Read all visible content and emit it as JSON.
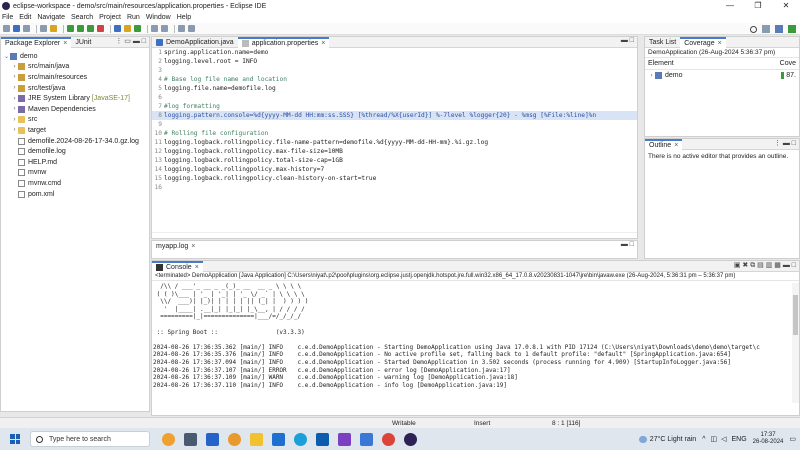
{
  "window": {
    "title": "eclipse-workspace - demo/src/main/resources/application.properties - Eclipse IDE",
    "controls": [
      "—",
      "❐",
      "✕"
    ]
  },
  "menu": [
    "File",
    "Edit",
    "Navigate",
    "Search",
    "Project",
    "Run",
    "Window",
    "Help"
  ],
  "explorer": {
    "tabs": [
      "Package Explorer",
      "JUnit"
    ],
    "items": [
      {
        "indent": 0,
        "twisty": "⌄",
        "icon": "proj",
        "label": "demo",
        "deco": ""
      },
      {
        "indent": 1,
        "twisty": "›",
        "icon": "pkg",
        "label": "src/main/java",
        "deco": ""
      },
      {
        "indent": 1,
        "twisty": "›",
        "icon": "pkg",
        "label": "src/main/resources",
        "deco": ""
      },
      {
        "indent": 1,
        "twisty": "›",
        "icon": "pkg",
        "label": "src/test/java",
        "deco": ""
      },
      {
        "indent": 1,
        "twisty": "›",
        "icon": "jar",
        "label": "JRE System Library",
        "deco": "[JavaSE-17]"
      },
      {
        "indent": 1,
        "twisty": "›",
        "icon": "jar",
        "label": "Maven Dependencies",
        "deco": ""
      },
      {
        "indent": 1,
        "twisty": "›",
        "icon": "folder",
        "label": "src",
        "deco": ""
      },
      {
        "indent": 1,
        "twisty": "›",
        "icon": "folder",
        "label": "target",
        "deco": ""
      },
      {
        "indent": 1,
        "twisty": "",
        "icon": "file",
        "label": "demofile.2024-08-26-17-34.0.gz.log",
        "deco": ""
      },
      {
        "indent": 1,
        "twisty": "",
        "icon": "file",
        "label": "demofile.log",
        "deco": ""
      },
      {
        "indent": 1,
        "twisty": "",
        "icon": "file",
        "label": "HELP.md",
        "deco": ""
      },
      {
        "indent": 1,
        "twisty": "",
        "icon": "file",
        "label": "mvnw",
        "deco": ""
      },
      {
        "indent": 1,
        "twisty": "",
        "icon": "file",
        "label": "mvnw.cmd",
        "deco": ""
      },
      {
        "indent": 1,
        "twisty": "",
        "icon": "file",
        "label": "pom.xml",
        "deco": ""
      }
    ]
  },
  "editor": {
    "tabs": [
      "DemoApplication.java",
      "application.properties"
    ],
    "active_tab": 1,
    "lines": [
      {
        "n": "1",
        "text": "spring.application.name=demo",
        "kind": "prop"
      },
      {
        "n": "2",
        "text": "logging.level.root = INFO",
        "kind": "prop"
      },
      {
        "n": "3",
        "text": "",
        "kind": "prop"
      },
      {
        "n": "4",
        "text": "# Base log file name and location",
        "kind": "comment"
      },
      {
        "n": "5",
        "text": "logging.file.name=demofile.log",
        "kind": "prop"
      },
      {
        "n": "6",
        "text": "",
        "kind": "prop"
      },
      {
        "n": "7",
        "text": "#log formatting",
        "kind": "comment"
      },
      {
        "n": "8",
        "text": "logging.pattern.console=%d{yyyy-MM-dd HH:mm:ss.SSS} [%thread/%X{userId}] %-7level %logger{20} - %msg [%File:%line]%n",
        "kind": "highlight"
      },
      {
        "n": "9",
        "text": "",
        "kind": "prop"
      },
      {
        "n": "10",
        "text": "# Rolling file configuration",
        "kind": "comment"
      },
      {
        "n": "11",
        "text": "logging.logback.rollingpolicy.file-name-pattern=demofile.%d{yyyy-MM-dd-HH-mm}.%i.gz.log",
        "kind": "prop"
      },
      {
        "n": "12",
        "text": "logging.logback.rollingpolicy.max-file-size=10MB",
        "kind": "prop"
      },
      {
        "n": "13",
        "text": "logging.logback.rollingpolicy.total-size-cap=1GB",
        "kind": "prop"
      },
      {
        "n": "14",
        "text": "logging.logback.rollingpolicy.max-history=7",
        "kind": "prop"
      },
      {
        "n": "15",
        "text": "logging.logback.rollingpolicy.clean-history-on-start=true",
        "kind": "prop"
      },
      {
        "n": "16",
        "text": "",
        "kind": "prop"
      }
    ]
  },
  "myapp_tab": "myapp.log",
  "right_top": {
    "tabs": [
      "Task List",
      "Coverage"
    ],
    "session": "DemoApplication (26-Aug-2024 5:36:37 pm)",
    "col_element": "Element",
    "col_coverage": "Cove",
    "row_label": "demo",
    "row_value": "87."
  },
  "outline": {
    "tab": "Outline",
    "message": "There is no active editor that provides an outline."
  },
  "console": {
    "tab": "Console",
    "info": "<terminated> DemoApplication [Java Application] C:\\Users\\niyat\\.p2\\pool\\plugins\\org.eclipse.justj.openjdk.hotspot.jre.full.win32.x86_64_17.0.8.v20230831-1047\\jre\\bin\\javaw.exe  (26-Aug-2024, 5:36:31 pm – 5:36:37 pm)",
    "lines": [
      "  /\\\\ / ___'_ __ _ _(_)_ __  __ _ \\ \\ \\ \\",
      " ( ( )\\___ | '_ | '_| | '_ \\/ _` | \\ \\ \\ \\",
      "  \\\\/  ___)| |_)| | | | | || (_| |  ) ) ) )",
      "   '  |____| .__|_| |_|_| |_\\__, | / / / /",
      "  =========|_|==============|___/=/_/_/_/",
      "",
      " :: Spring Boot ::                (v3.3.3)",
      "",
      "2024-08-26 17:36:35.362 [main/] INFO    c.e.d.DemoApplication - Starting DemoApplication using Java 17.0.8.1 with PID 17124 (C:\\Users\\niyat\\Downloads\\demo\\demo\\target\\c",
      "2024-08-26 17:36:35.376 [main/] INFO    c.e.d.DemoApplication - No active profile set, falling back to 1 default profile: \"default\" [SpringApplication.java:654]",
      "2024-08-26 17:36:37.094 [main/] INFO    c.e.d.DemoApplication - Started DemoApplication in 3.502 seconds (process running for 4.909) [StartupInfoLogger.java:56]",
      "2024-08-26 17:36:37.107 [main/] ERROR   c.e.d.DemoApplication - error log [DemoApplication.java:17]",
      "2024-08-26 17:36:37.109 [main/] WARN    c.e.d.DemoApplication - warning log [DemoApplication.java:18]",
      "2024-08-26 17:36:37.110 [main/] INFO    c.e.d.DemoApplication - info log [DemoApplication.java:19]"
    ]
  },
  "status": {
    "writable": "Writable",
    "insert": "Insert",
    "position": "8 : 1 [116]"
  },
  "taskbar": {
    "search_placeholder": "Type here to search",
    "weather": "27°C  Light rain",
    "lang": "ENG",
    "time": "17:37",
    "date": "26-08-2024"
  }
}
